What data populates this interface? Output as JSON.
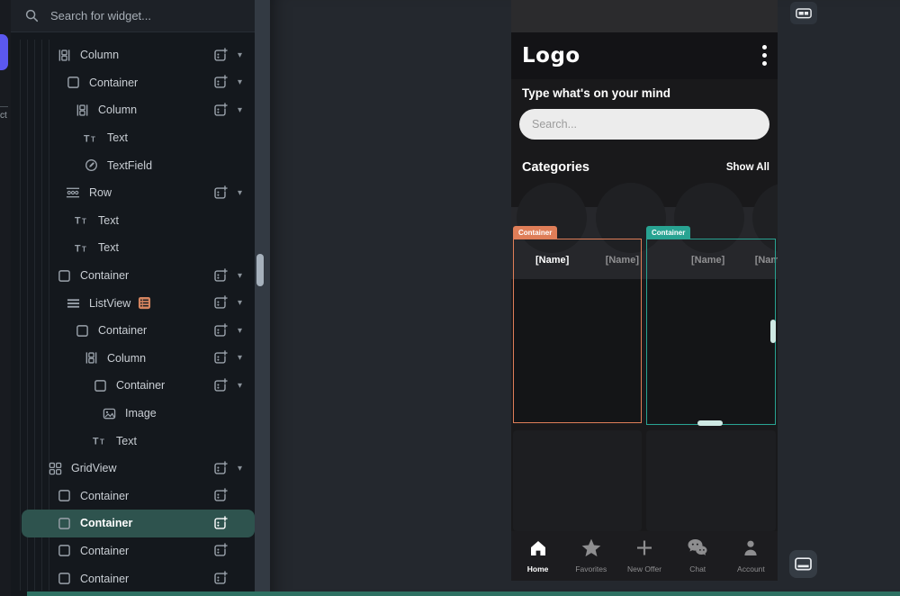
{
  "left_rail": {
    "label_fragment": "ct"
  },
  "tree_panel": {
    "search_placeholder": "Search for widget...",
    "items": [
      {
        "label": "Column",
        "icon": "column-icon",
        "indent": 2,
        "add": true,
        "caret": true
      },
      {
        "label": "Container",
        "icon": "container-icon",
        "indent": 3,
        "add": true,
        "caret": true
      },
      {
        "label": "Column",
        "icon": "column-icon",
        "indent": 4,
        "add": true,
        "caret": true
      },
      {
        "label": "Text",
        "icon": "text-icon",
        "indent": 5
      },
      {
        "label": "TextField",
        "icon": "textfield-icon",
        "indent": 5
      },
      {
        "label": "Row",
        "icon": "row-icon",
        "indent": 3,
        "add": true,
        "caret": true
      },
      {
        "label": "Text",
        "icon": "text-icon",
        "indent": 4
      },
      {
        "label": "Text",
        "icon": "text-icon",
        "indent": 4
      },
      {
        "label": "Container",
        "icon": "container-icon",
        "indent": 2,
        "add": true,
        "caret": true
      },
      {
        "label": "ListView",
        "icon": "listview-icon",
        "badge": "listview-badge-icon",
        "indent": 3,
        "add": true,
        "caret": true
      },
      {
        "label": "Container",
        "icon": "container-icon",
        "indent": 4,
        "add": true,
        "caret": true
      },
      {
        "label": "Column",
        "icon": "column-icon",
        "indent": 5,
        "add": true,
        "caret": true
      },
      {
        "label": "Container",
        "icon": "container-icon",
        "indent": 6,
        "add": true,
        "caret": true
      },
      {
        "label": "Image",
        "icon": "image-icon",
        "indent": 7
      },
      {
        "label": "Text",
        "icon": "text-icon",
        "indent": 6
      },
      {
        "label": "GridView",
        "icon": "gridview-icon",
        "indent": 1,
        "add": true,
        "caret": true
      },
      {
        "label": "Container",
        "icon": "container-icon",
        "indent": 2,
        "add": true
      },
      {
        "label": "Container",
        "icon": "container-icon",
        "indent": 2,
        "add": true,
        "selected": true
      },
      {
        "label": "Container",
        "icon": "container-icon",
        "indent": 2,
        "add": true
      },
      {
        "label": "Container",
        "icon": "container-icon",
        "indent": 2,
        "add": true
      }
    ]
  },
  "canvas": {
    "phone": {
      "app_bar": {
        "title": "Logo",
        "menu_icon": "kebab-menu-icon"
      },
      "prompt": "Type what's on your mind",
      "search_placeholder": "Search...",
      "categories_title": "Categories",
      "categories_action": "Show All",
      "category_circle_count": 4,
      "grid_overlays": [
        {
          "tag": "Container",
          "color": "#df7e58",
          "labels": [
            {
              "text": "[Name]",
              "emphasis": true
            },
            {
              "text": "[Name]",
              "emphasis": false
            }
          ]
        },
        {
          "tag": "Container",
          "color": "#28a392",
          "labels": [
            {
              "text": "[Name]",
              "emphasis": false
            },
            {
              "text": "[Name]",
              "emphasis": false
            }
          ]
        }
      ],
      "nav_items": [
        {
          "label": "Home",
          "icon": "home-icon",
          "active": true
        },
        {
          "label": "Favorites",
          "icon": "star-icon",
          "active": false
        },
        {
          "label": "New Offer",
          "icon": "plus-icon",
          "active": false
        },
        {
          "label": "Chat",
          "icon": "chat-icon",
          "active": false
        },
        {
          "label": "Account",
          "icon": "account-icon",
          "active": false
        }
      ]
    },
    "top_right_button_icon": "toggle-panels-icon",
    "bottom_right_button_icon": "dock-bottom-icon"
  },
  "colors": {
    "selection_teal": "#2e534e",
    "overlay_orange": "#df7e58",
    "overlay_teal": "#28a392",
    "accent_purple": "#5b58f0",
    "bottom_strip_teal": "#2e7163"
  }
}
